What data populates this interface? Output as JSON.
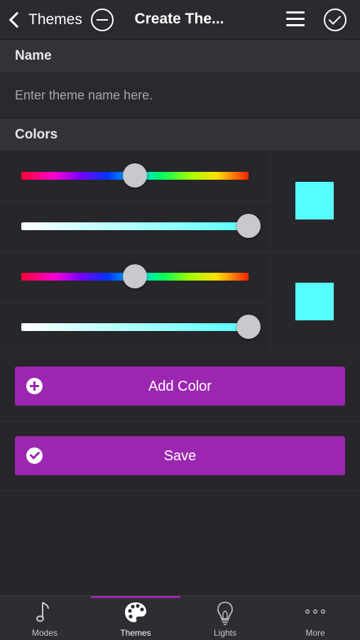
{
  "header": {
    "back_label": "Themes",
    "title": "Create The..."
  },
  "sections": {
    "name_label": "Name",
    "colors_label": "Colors"
  },
  "name_field": {
    "value": "",
    "placeholder": "Enter theme name here."
  },
  "colors": [
    {
      "hue_position": 0.5,
      "saturation_position": 1.0,
      "swatch": "#55ffff"
    },
    {
      "hue_position": 0.5,
      "saturation_position": 1.0,
      "swatch": "#55ffff"
    }
  ],
  "buttons": {
    "add_color": "Add Color",
    "save": "Save"
  },
  "accent_color": "#9b27b0",
  "tabs": [
    {
      "label": "Modes",
      "icon": "music-note-icon",
      "active": false
    },
    {
      "label": "Themes",
      "icon": "palette-icon",
      "active": true
    },
    {
      "label": "Lights",
      "icon": "lightbulb-icon",
      "active": false
    },
    {
      "label": "More",
      "icon": "more-dots-icon",
      "active": false
    }
  ]
}
